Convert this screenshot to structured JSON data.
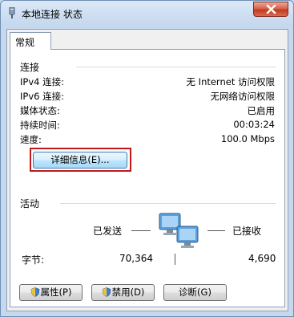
{
  "window": {
    "title": "本地连接 状态"
  },
  "tabs": [
    {
      "label": "常规"
    }
  ],
  "connection": {
    "section_label": "连接",
    "rows": [
      {
        "label": "IPv4 连接:",
        "value": "无 Internet 访问权限"
      },
      {
        "label": "IPv6 连接:",
        "value": "无网络访问权限"
      },
      {
        "label": "媒体状态:",
        "value": "已启用"
      },
      {
        "label": "持续时间:",
        "value": "00:03:24"
      },
      {
        "label": "速度:",
        "value": "100.0 Mbps"
      }
    ],
    "details_button": "详细信息(E)..."
  },
  "activity": {
    "section_label": "活动",
    "sent_label": "已发送",
    "received_label": "已接收",
    "bytes_label": "字节:",
    "bytes_sent": "70,364",
    "bytes_received": "4,690"
  },
  "buttons": {
    "properties": "属性(P)",
    "disable": "禁用(D)",
    "diagnose": "诊断(G)"
  },
  "colors": {
    "highlight_box": "#c0181b",
    "close_button": "#c13b22"
  }
}
